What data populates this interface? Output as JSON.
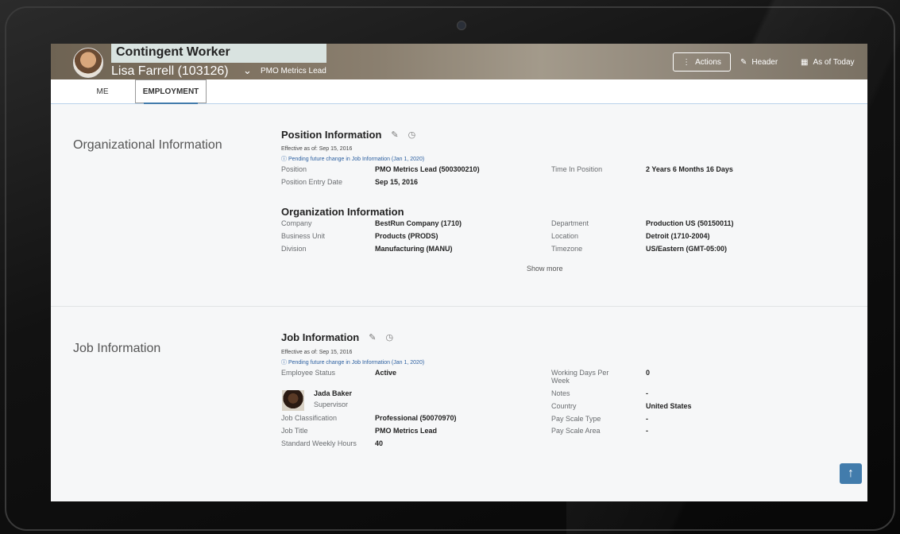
{
  "header": {
    "title": "Contingent Worker",
    "name": "Lisa Farrell (103126)",
    "position": "PMO Metrics Lead",
    "actions_label": "Actions",
    "header_label": "Header",
    "asof_label": "As of Today"
  },
  "tabs": [
    {
      "label": "ME"
    },
    {
      "label": "EMPLOYMENT"
    }
  ],
  "org": {
    "section_title": "Organizational Information",
    "position_info": {
      "title": "Position Information",
      "effective": "Effective as of: Sep 15, 2016",
      "pending": "Pending future change in Job Information (Jan 1, 2020)",
      "position_label": "Position",
      "position_value": "PMO Metrics Lead (500300210)",
      "entry_label": "Position Entry Date",
      "entry_value": "Sep 15, 2016",
      "time_label": "Time In Position",
      "time_value": "2 Years 6 Months 16 Days"
    },
    "org_info": {
      "title": "Organization Information",
      "company_label": "Company",
      "company_value": "BestRun Company (1710)",
      "bu_label": "Business Unit",
      "bu_value": "Products (PRODS)",
      "division_label": "Division",
      "division_value": "Manufacturing (MANU)",
      "dept_label": "Department",
      "dept_value": "Production US (50150011)",
      "location_label": "Location",
      "location_value": "Detroit (1710-2004)",
      "tz_label": "Timezone",
      "tz_value": "US/Eastern (GMT-05:00)"
    },
    "show_more": "Show more"
  },
  "job": {
    "section_title": "Job Information",
    "title": "Job Information",
    "effective": "Effective as of: Sep 15, 2016",
    "pending": "Pending future change in Job Information (Jan 1, 2020)",
    "status_label": "Employee Status",
    "status_value": "Active",
    "supervisor_name": "Jada Baker",
    "supervisor_role": "Supervisor",
    "class_label": "Job Classification",
    "class_value": "Professional (50070970)",
    "jobtitle_label": "Job Title",
    "jobtitle_value": "PMO Metrics Lead",
    "hours_label": "Standard Weekly Hours",
    "hours_value": "40",
    "wdays_label": "Working Days Per Week",
    "wdays_value": "0",
    "notes_label": "Notes",
    "notes_value": "-",
    "country_label": "Country",
    "country_value": "United States",
    "pst_label": "Pay Scale Type",
    "pst_value": "-",
    "psa_label": "Pay Scale Area",
    "psa_value": "-"
  }
}
